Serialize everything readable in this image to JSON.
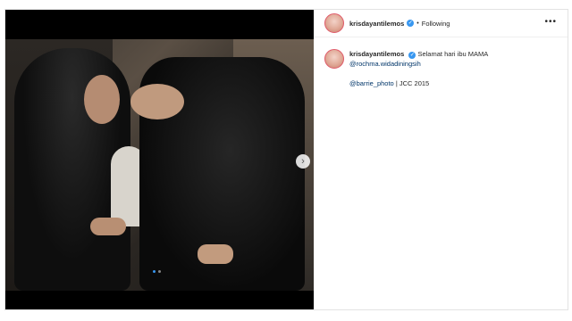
{
  "post": {
    "username": "krisdayantilemos",
    "separator": "•",
    "follow_status": "Following",
    "more_icon_text": "•••",
    "next_icon_text": "›",
    "verified_icon_text": "✓",
    "caption": {
      "text": " Selamat hari ibu MAMA",
      "mention": "@rochma.widadiningsih",
      "credit_mention": "@barrie_photo",
      "credit_suffix": " | JCC 2015"
    },
    "carousel": {
      "slide_count": 2,
      "active_index": 0
    }
  },
  "colors": {
    "verified": "#3897f0",
    "mention": "#003569",
    "active_dot": "#3897f0"
  },
  "icons": [
    "verified-badge-icon",
    "more-options-icon",
    "chevron-right-icon"
  ]
}
